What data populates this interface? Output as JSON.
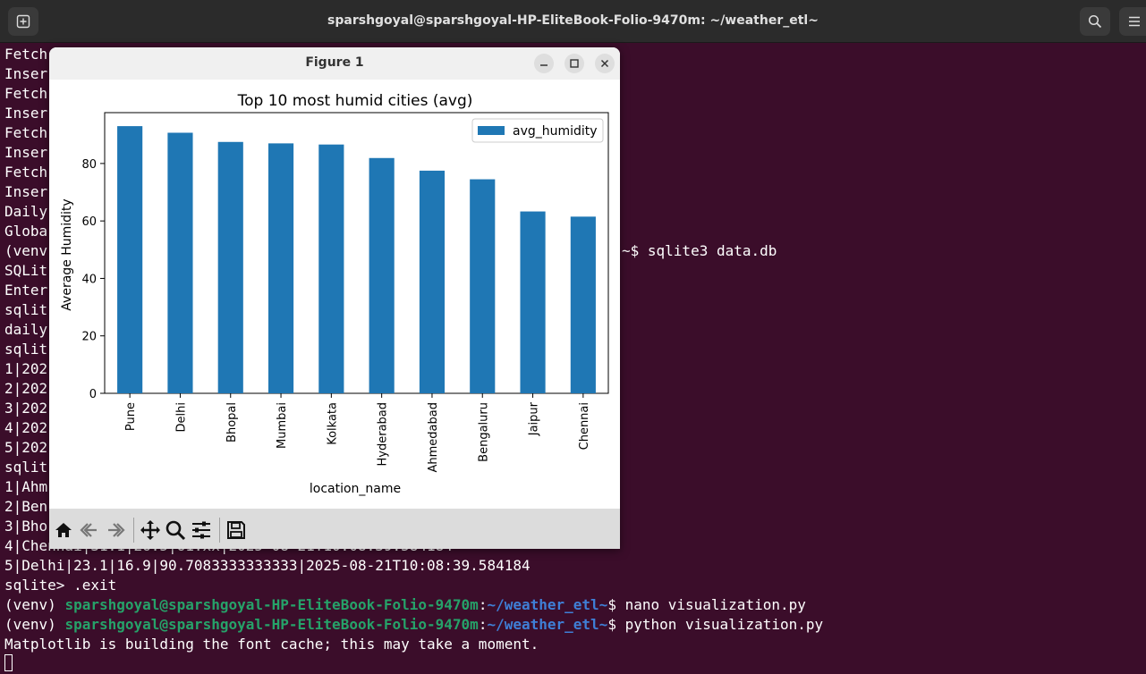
{
  "terminal": {
    "title": "sparshgoyal@sparshgoyal-HP-EliteBook-Folio-9470m: ~/weather_etl~",
    "lines": [
      "Fetch",
      "Inser",
      "Fetch",
      "Inser",
      "Fetch",
      "Inser",
      "Fetch",
      "Inser",
      "Daily",
      "Globa",
      "(venv",
      "SQLit",
      "Enter",
      "sqlit",
      "daily",
      "sqlit",
      "1|202",
      "2|202",
      "3|202",
      "4|202",
      "5|202",
      "sqlit",
      "1|Ahm",
      "2|Ben",
      "3|Bho",
      "4|Chennai|31.1|26.5|61.xx|2025-08-21T10:08:39.584184",
      "5|Delhi|23.1|16.9|90.7083333333333|2025-08-21T10:08:39.584184",
      "sqlite> .exit"
    ],
    "partial_right": "~$ sqlite3 data.db",
    "prompt_prefix": "(venv) ",
    "prompt_user": "sparshgoyal@sparshgoyal-HP-EliteBook-Folio-9470m",
    "prompt_colon": ":",
    "prompt_path": "~/weather_etl~",
    "prompt_dollar": "$ ",
    "cmd1": "nano visualization.py",
    "cmd2": "python visualization.py",
    "last_output": "Matplotlib is building the font cache; this may take a moment."
  },
  "figure": {
    "window_title": "Figure 1",
    "icons": {
      "minimize": "minimize-icon",
      "maximize": "maximize-icon",
      "close": "close-icon",
      "home": "home-icon",
      "back": "back-arrow-icon",
      "forward": "forward-arrow-icon",
      "pan": "pan-icon",
      "zoom": "zoom-icon",
      "configure": "configure-subplots-icon",
      "save": "save-icon"
    }
  },
  "chart_data": {
    "type": "bar",
    "title": "Top 10 most humid cities (avg)",
    "xlabel": "location_name",
    "ylabel": "Average Humidity",
    "categories": [
      "Pune",
      "Delhi",
      "Bhopal",
      "Mumbai",
      "Kolkata",
      "Hyderabad",
      "Ahmedabad",
      "Bengaluru",
      "Jaipur",
      "Chennai"
    ],
    "series": [
      {
        "name": "avg_humidity",
        "values": [
          93.0,
          90.7,
          87.5,
          87.0,
          86.6,
          81.9,
          77.5,
          74.5,
          63.3,
          61.5
        ]
      }
    ],
    "yticks": [
      0,
      20,
      40,
      60,
      80
    ],
    "ylim": [
      0,
      97.7
    ],
    "legend_position": "upper right",
    "color": "#1f77b4",
    "grid": false
  }
}
